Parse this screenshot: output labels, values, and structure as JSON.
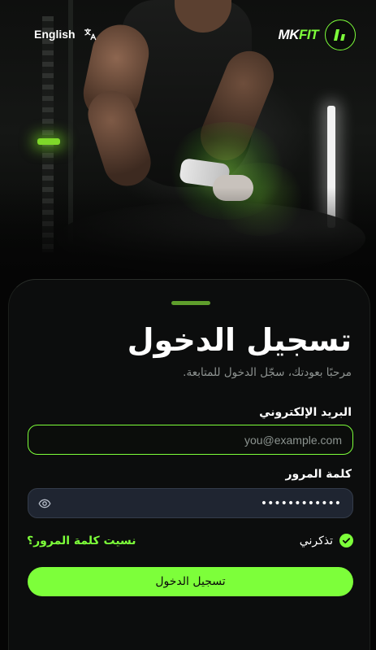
{
  "app": {
    "logo_mk": "MK",
    "logo_fit": "FIT",
    "accent_color": "#7dff3a"
  },
  "topbar": {
    "language_label": "English",
    "language_icon": "translate-icon",
    "logo_icon": "mkfit-logo-icon"
  },
  "login": {
    "title": "تسجيل الدخول",
    "subtitle": "مرحبًا بعودتك، سجّل الدخول للمتابعة.",
    "email_label": "البريد الإلكتروني",
    "email_placeholder": "you@example.com",
    "email_value": "",
    "password_label": "كلمة المرور",
    "password_value": "••••••••••••",
    "password_toggle_icon": "eye-icon",
    "remember_label": "تذكرني",
    "remember_checked": true,
    "forgot_label": "نسيت كلمة المرور؟",
    "submit_label": "تسجيل الدخول"
  }
}
